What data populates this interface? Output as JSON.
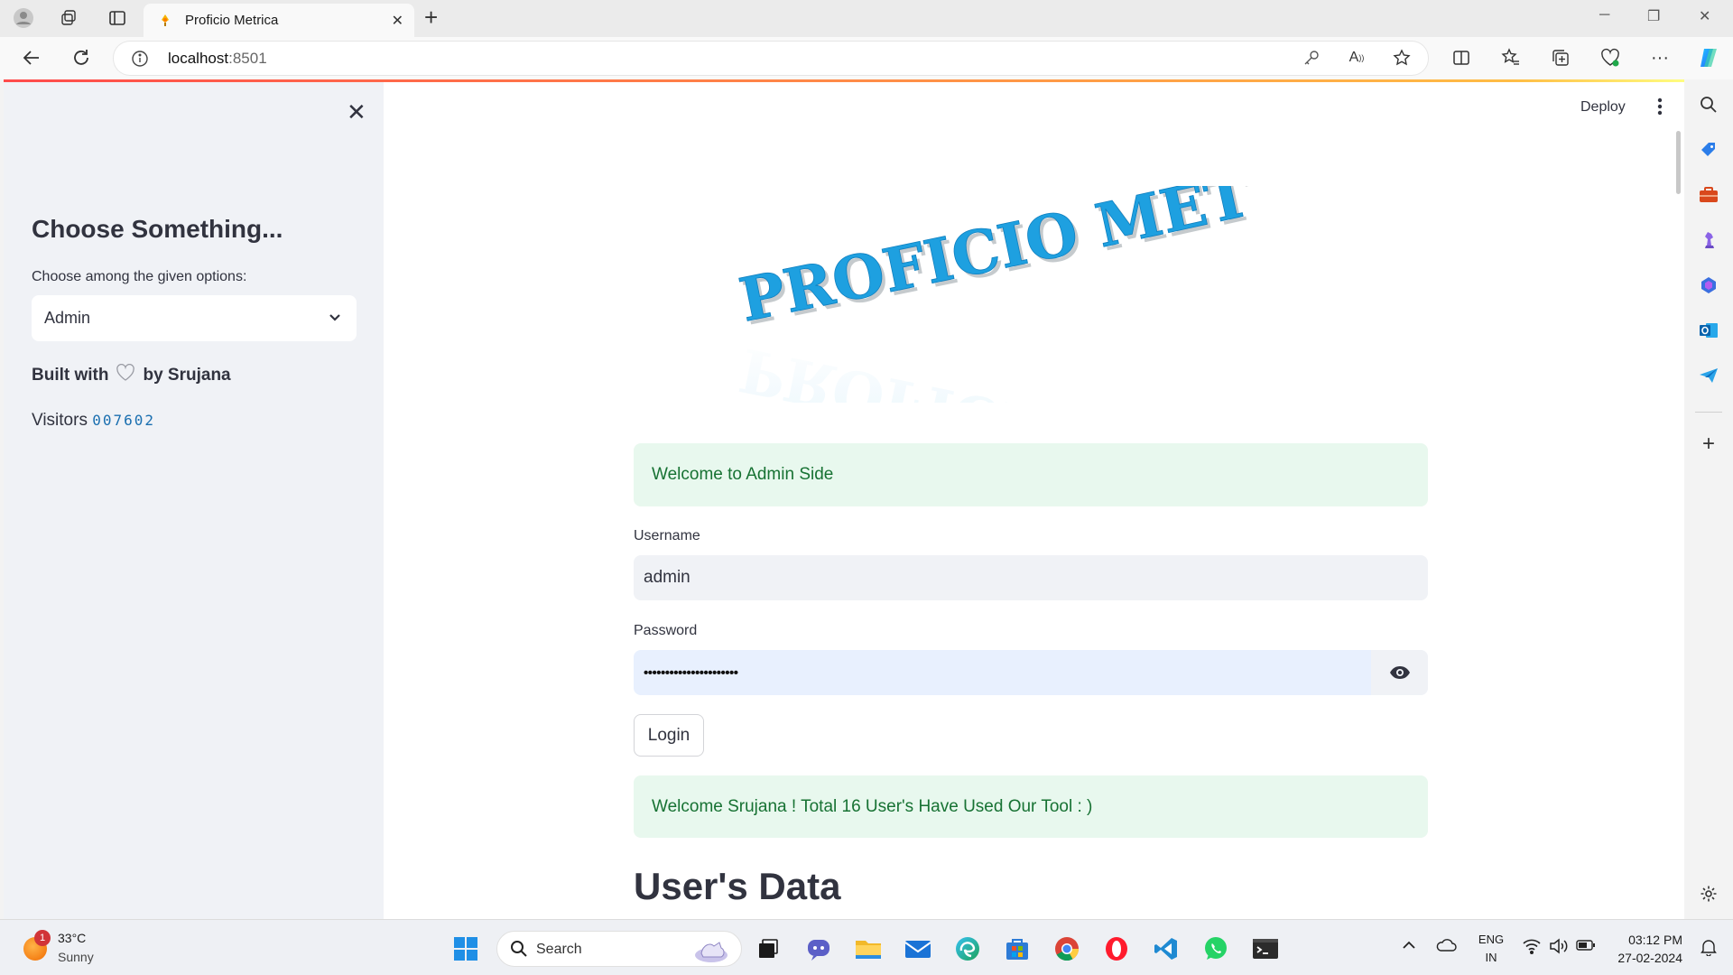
{
  "browser": {
    "tab_title": "Proficio Metrica",
    "url_host": "localhost",
    "url_port": ":8501"
  },
  "sidebar": {
    "heading": "Choose Something...",
    "select_label": "Choose among the given options:",
    "select_value": "Admin",
    "built_with": "Built with",
    "built_by": "by Srujana",
    "visitors_label": "Visitors",
    "visitors_count": "007602"
  },
  "header": {
    "deploy_label": "Deploy"
  },
  "logo": {
    "text": "PROFICIO METRICA",
    "color": "#1ea0e0"
  },
  "main": {
    "welcome_alert": "Welcome to Admin Side",
    "username_label": "Username",
    "username_value": "admin",
    "password_label": "Password",
    "password_value": "••••••••••••••••••••••",
    "login_label": "Login",
    "success_alert": "Welcome Srujana ! Total 16 User's Have Used Our Tool : )",
    "section_heading": "User's Data"
  },
  "taskbar": {
    "weather_badge": "1",
    "weather_temp": "33°C",
    "weather_desc": "Sunny",
    "search_placeholder": "Search",
    "lang_1": "ENG",
    "lang_2": "IN",
    "time": "03:12 PM",
    "date": "27-02-2024"
  },
  "colors": {
    "alert_bg": "#e8f8ee",
    "alert_text": "#177233",
    "sidebar_bg": "#f0f2f6",
    "logo_blue": "#1ea0e0"
  }
}
